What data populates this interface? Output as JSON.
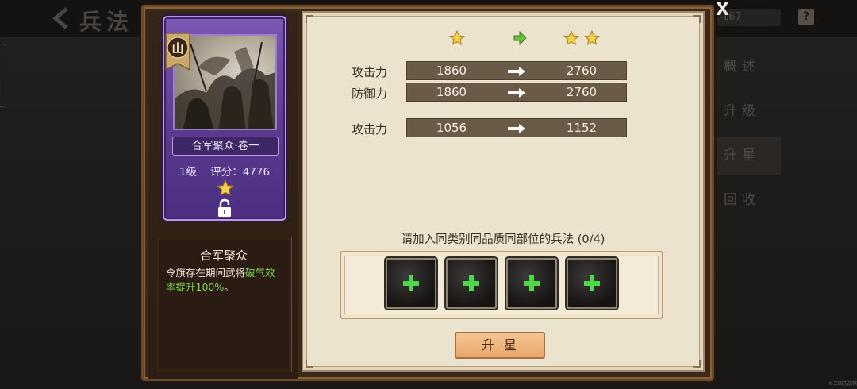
{
  "background": {
    "back_icon": "chevron-left-icon",
    "title": "兵法",
    "count_text": "167",
    "help_label": "?",
    "side_tabs": [
      "概述",
      "升级",
      "升星",
      "回收"
    ],
    "active_tab_index": 2
  },
  "close_label": "X",
  "card": {
    "badge_label": "山",
    "name": "合军聚众·卷一",
    "level": "1级",
    "score_label": "评分：",
    "score": "4776",
    "stars": 1,
    "locked": true,
    "theme_color": "#6a47a4"
  },
  "description": {
    "title": "合军聚众",
    "text_before": "令旗存在期间武将",
    "text_highlight": "破气效率提升100%",
    "text_after": "。",
    "highlight_color": "#7ed957"
  },
  "upgrade": {
    "current_stars": 1,
    "next_stars": 2,
    "stats": [
      {
        "label": "攻击力",
        "from": "1860",
        "to": "2760"
      },
      {
        "label": "防御力",
        "from": "1860",
        "to": "2760"
      },
      {
        "label": "攻击力",
        "from": "1056",
        "to": "1152"
      }
    ],
    "hint": "请加入同类别同品质同部位的兵法 (0/4)",
    "slot_count": 4,
    "button_label": "升星"
  },
  "watermark": "©三国志战棋"
}
